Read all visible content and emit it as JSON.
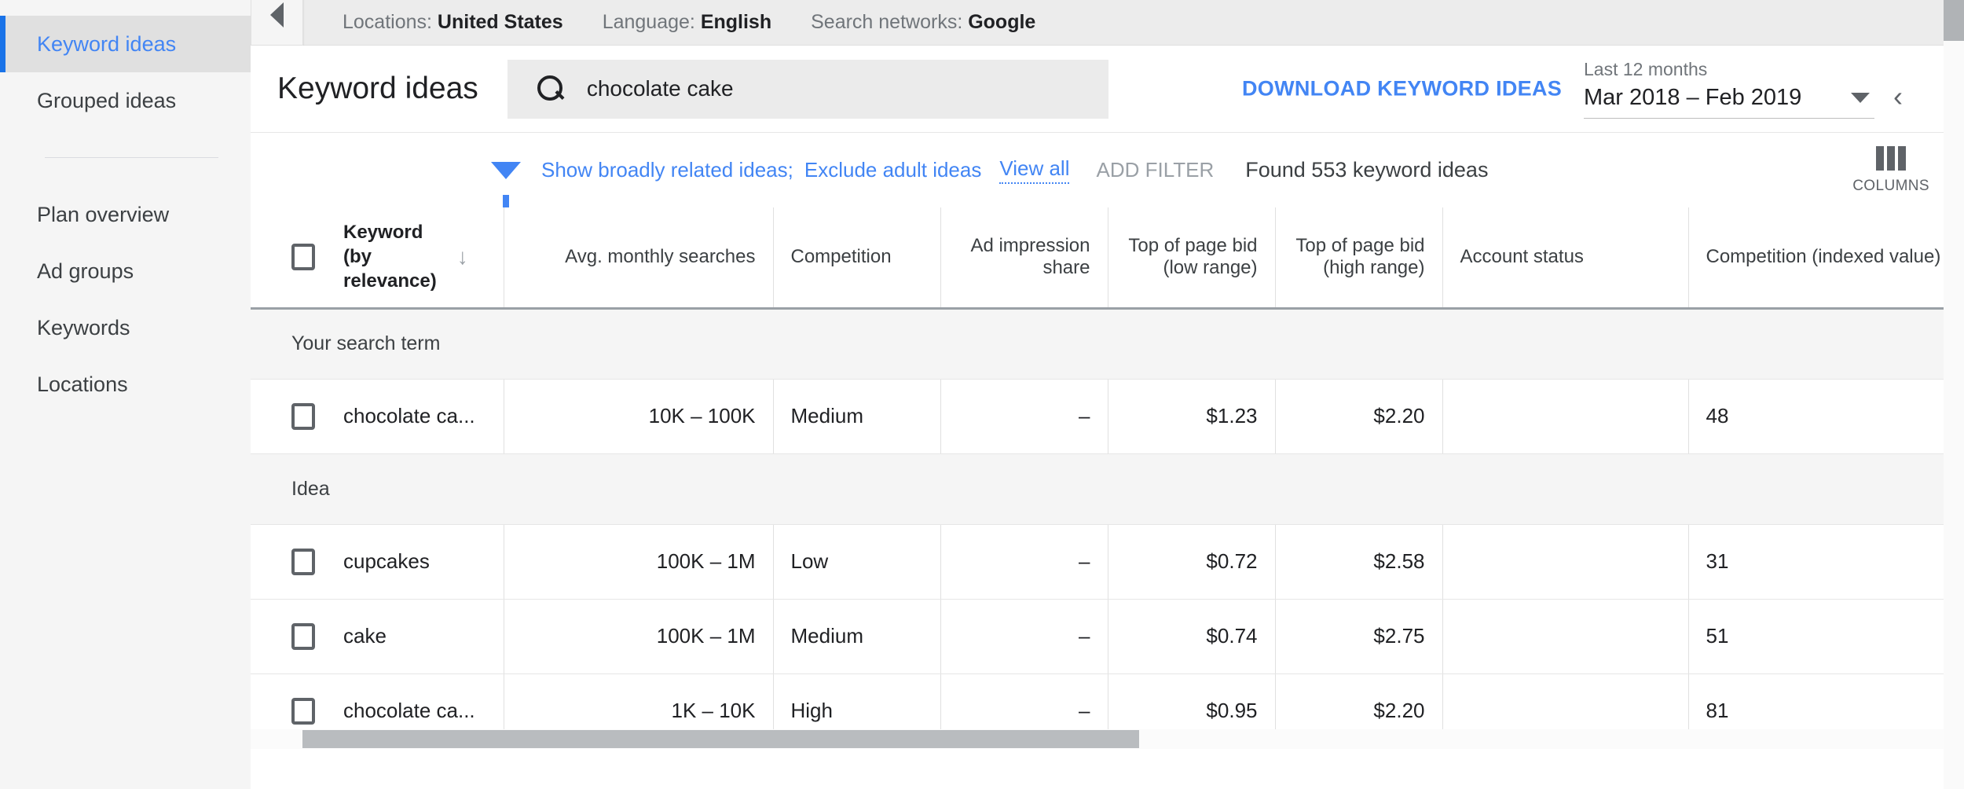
{
  "sidebar": {
    "items": [
      {
        "label": "Keyword ideas",
        "active": true
      },
      {
        "label": "Grouped ideas",
        "active": false
      },
      {
        "label": "Plan overview",
        "active": false
      },
      {
        "label": "Ad groups",
        "active": false
      },
      {
        "label": "Keywords",
        "active": false
      },
      {
        "label": "Locations",
        "active": false
      }
    ]
  },
  "topbar": {
    "collapse_icon": "triangle-left-icon",
    "settings": [
      {
        "label": "Locations:",
        "value": "United States"
      },
      {
        "label": "Language:",
        "value": "English"
      },
      {
        "label": "Search networks:",
        "value": "Google"
      }
    ]
  },
  "header": {
    "title": "Keyword ideas",
    "search": {
      "icon": "search-icon",
      "value": "chocolate cake",
      "placeholder": ""
    },
    "download_label": "DOWNLOAD KEYWORD IDEAS",
    "date_range": {
      "preset": "Last 12 months",
      "value": "Mar 2018 – Feb 2019",
      "dropdown_icon": "caret-down-icon",
      "collapse_icon": "chevron-left-icon"
    }
  },
  "filters": {
    "funnel_icon": "filter-funnel-icon",
    "chips": [
      "Show broadly related ideas;",
      "Exclude adult ideas"
    ],
    "view_all": "View all",
    "add_filter": "ADD FILTER",
    "found": "Found 553 keyword ideas",
    "columns": {
      "icon": "columns-icon",
      "label": "COLUMNS"
    }
  },
  "table": {
    "sort_icon": "arrow-down-icon",
    "select_all_checkbox": "checkbox-unchecked",
    "columns": [
      "Keyword (by relevance)",
      "Avg. monthly searches",
      "Competition",
      "Ad impression share",
      "Top of page bid (low range)",
      "Top of page bid (high range)",
      "Account status",
      "Competition (indexed value)"
    ],
    "keyword_header_lines": [
      "Keyword",
      "(by",
      "relevance)"
    ],
    "groups": [
      {
        "title": "Your search term",
        "rows": [
          {
            "keyword": "chocolate ca...",
            "avg_monthly_searches": "10K – 100K",
            "competition": "Medium",
            "ad_impression_share": "–",
            "bid_low": "$1.23",
            "bid_high": "$2.20",
            "account_status": "",
            "competition_index": "48"
          }
        ]
      },
      {
        "title": "Idea",
        "rows": [
          {
            "keyword": "cupcakes",
            "avg_monthly_searches": "100K – 1M",
            "competition": "Low",
            "ad_impression_share": "–",
            "bid_low": "$0.72",
            "bid_high": "$2.58",
            "account_status": "",
            "competition_index": "31"
          },
          {
            "keyword": "cake",
            "avg_monthly_searches": "100K – 1M",
            "competition": "Medium",
            "ad_impression_share": "–",
            "bid_low": "$0.74",
            "bid_high": "$2.75",
            "account_status": "",
            "competition_index": "51"
          },
          {
            "keyword": "chocolate ca...",
            "avg_monthly_searches": "1K – 10K",
            "competition": "High",
            "ad_impression_share": "–",
            "bid_low": "$0.95",
            "bid_high": "$2.20",
            "account_status": "",
            "competition_index": "81"
          }
        ]
      }
    ]
  },
  "colors": {
    "accent_blue": "#4285f4",
    "active_blue": "#1a73e8",
    "sidebar_bg": "#f5f5f5",
    "topbar_bg": "#ececec",
    "text_primary": "#202124",
    "text_secondary": "#70757a"
  }
}
